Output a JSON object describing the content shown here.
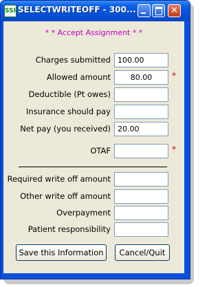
{
  "window": {
    "title": "SELECTWRITEOFF - 300...",
    "app_icon_text": "SSI"
  },
  "banner": "* * Accept Assignment * *",
  "fields": [
    {
      "label": "Charges submitted",
      "value": "100.00",
      "required": false
    },
    {
      "label": "Allowed amount",
      "value": "80.00",
      "required": true
    },
    {
      "label": "Deductible (Pt owes)",
      "value": "",
      "required": false
    },
    {
      "label": "Insurance should pay",
      "value": "",
      "required": false
    },
    {
      "label": "Net pay (you received)",
      "value": "20.00",
      "required": false
    },
    {
      "label": "OTAF",
      "value": "",
      "required": true
    },
    {
      "label": "Required write off amount",
      "value": "",
      "required": false
    },
    {
      "label": "Other write off amount",
      "value": "",
      "required": false
    },
    {
      "label": "Overpayment",
      "value": "",
      "required": false
    },
    {
      "label": "Patient responsibility",
      "value": "",
      "required": false
    }
  ],
  "required_marker": "*",
  "buttons": {
    "save": "Save this Information",
    "cancel": "Cancel/Quit"
  },
  "colors": {
    "titlebar": "#0a5fe6",
    "banner_text": "#c000c0",
    "required_marker": "#d00000",
    "dialog_bg": "#ece9d8"
  }
}
